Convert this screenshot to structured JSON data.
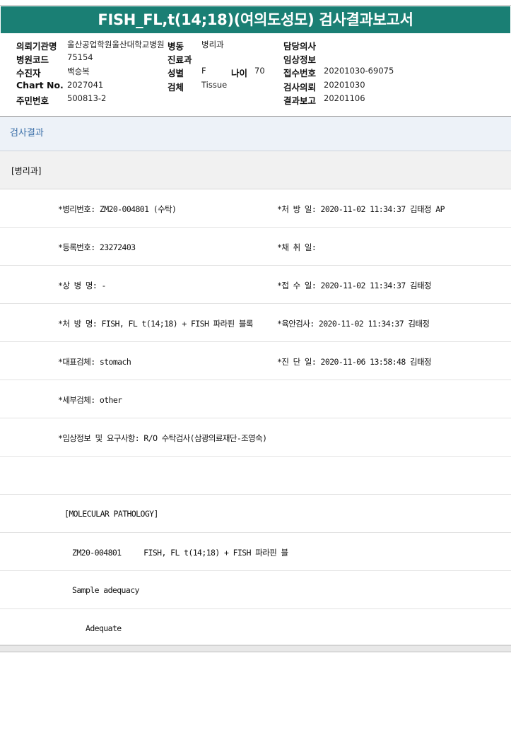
{
  "title": "FISH_FL,t(14;18)(여의도성모) 검사결과보고서",
  "header": {
    "row1": {
      "institution_label": "의뢰기관명",
      "institution_value": "울산공업학원울산대학교병원",
      "ward_label": "병동",
      "ward_value": "병리과",
      "doctor_label": "담당의사",
      "doctor_value": ""
    },
    "row2": {
      "hospital_code_label": "병원코드",
      "hospital_code_value": "75154",
      "dept_label": "진료과",
      "dept_value": "",
      "clinical_label": "임상정보",
      "clinical_value": ""
    },
    "row3": {
      "patient_label": "수진자",
      "patient_value": "백승복",
      "sex_label": "성별",
      "sex_value": "F",
      "age_label": "나이",
      "age_value": "70",
      "receipt_label": "접수번호",
      "receipt_value": "20201030-69075"
    },
    "row4": {
      "chart_label": "Chart No.",
      "chart_value": "2027041",
      "specimen_label": "검체",
      "specimen_value": "Tissue",
      "request_label": "검사의뢰",
      "request_value": "20201030"
    },
    "row5": {
      "resident_label": "주민번호",
      "resident_value": "500813-2",
      "report_label": "결과보고",
      "report_value": "20201106"
    }
  },
  "section_title": "검사결과",
  "department": "[병리과]",
  "results": {
    "pathology_no": "*병리번호: ZM20-004801 (수탁)",
    "prescription_date": "*처 방 일: 2020-11-02 11:34:37  김태정 AP",
    "registration_no": "*등록번호: 23272403",
    "collection_date": "*채 취 일:",
    "disease_name": "*상 병 명: -",
    "receipt_date": "*접 수 일: 2020-11-02 11:34:37  김태정",
    "prescription_name": "*처 방 명: FISH, FL t(14;18) + FISH 파라핀 블록",
    "gross_exam": "*육안검사: 2020-11-02 11:34:37  김태정",
    "main_specimen": "*대표검체: stomach",
    "diagnosis_date": "*진 단 일: 2020-11-06 13:58:48  김태정",
    "sub_specimen": "*세부검체: other",
    "clinical_info": "*임상정보 및 요구사항: R/O 수탁검사(삼광의료재단-조영숙)",
    "molecular_header": "[MOLECULAR PATHOLOGY]",
    "molecular_line": "ZM20-004801     FISH, FL t(14;18) + FISH 파라핀 블",
    "sample_adequacy": "Sample adequacy",
    "adequate": "Adequate"
  }
}
